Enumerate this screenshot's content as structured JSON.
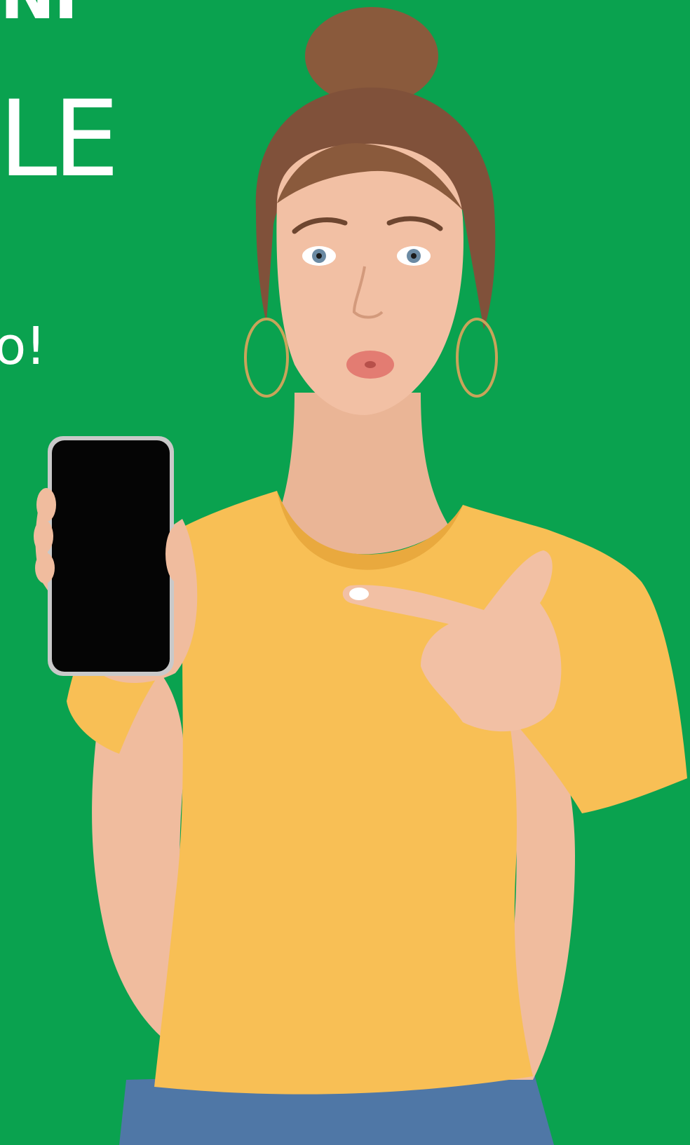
{
  "headline": {
    "top": "NI",
    "middle": "LE",
    "bottom": "o!"
  },
  "colors": {
    "background": "#0aa24f",
    "text": "#ffffff",
    "shirt": "#f8bf55",
    "skin": "#f2c0a4",
    "hair": "#8a5a3c",
    "phone_screen": "#050505",
    "jeans": "#4f77a6"
  }
}
